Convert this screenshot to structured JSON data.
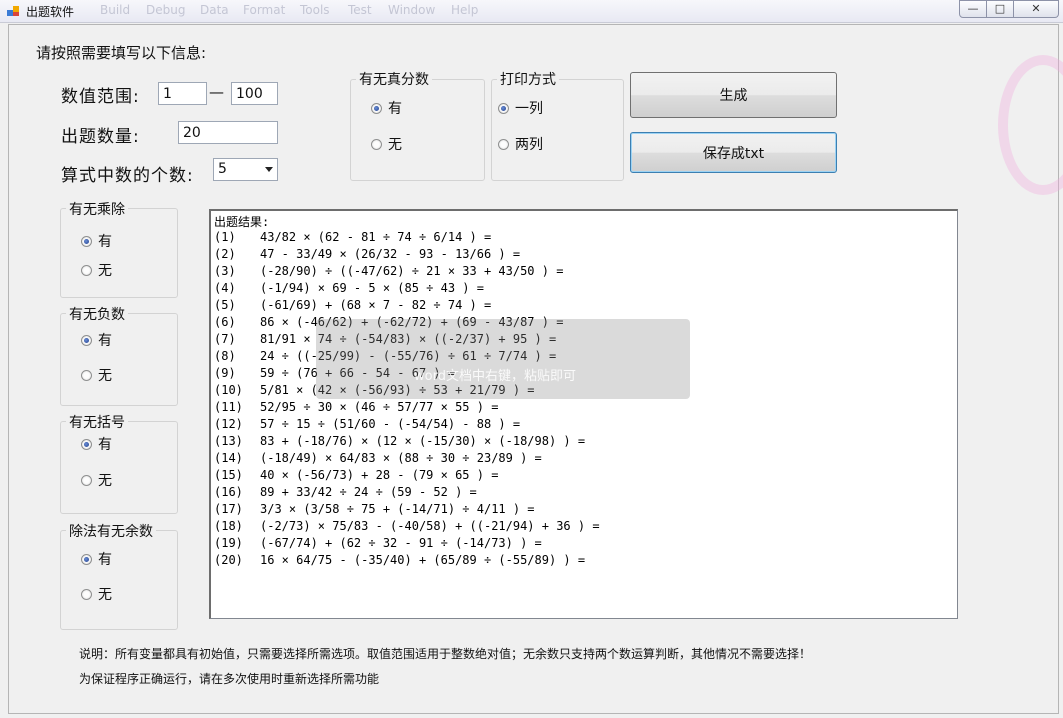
{
  "window": {
    "title": "出题软件",
    "ghost_menu": [
      "Build",
      "Debug",
      "Data",
      "Format",
      "Tools",
      "Test",
      "Window",
      "Help"
    ],
    "controls": {
      "minimize": "—",
      "maximize": "□",
      "close": "✕"
    }
  },
  "form": {
    "instruction": "请按照需要填写以下信息:",
    "range_label": "数值范围:",
    "range_min": "1",
    "range_dash": "—",
    "range_max": "100",
    "count_label": "出题数量:",
    "count_value": "20",
    "operand_label": "算式中数的个数:",
    "operand_value": "5"
  },
  "groups": {
    "fraction": {
      "title": "有无真分数",
      "options": [
        "有",
        "无"
      ],
      "selected": 0
    },
    "print": {
      "title": "打印方式",
      "options": [
        "一列",
        "两列"
      ],
      "selected": 0
    },
    "muldiv": {
      "title": "有无乘除",
      "options": [
        "有",
        "无"
      ],
      "selected": 0
    },
    "negative": {
      "title": "有无负数",
      "options": [
        "有",
        "无"
      ],
      "selected": 0
    },
    "parens": {
      "title": "有无括号",
      "options": [
        "有",
        "无"
      ],
      "selected": 0
    },
    "remainder": {
      "title": "除法有无余数",
      "options": [
        "有",
        "无"
      ],
      "selected": 0
    }
  },
  "buttons": {
    "generate": "生成",
    "save": "保存成txt"
  },
  "output": {
    "header": "出题结果:",
    "lines": [
      {
        "n": "(1)",
        "expr": "43/82 × (62 - 81 ÷ 74 ÷ 6/14 ) ="
      },
      {
        "n": "(2)",
        "expr": "47 - 33/49 × (26/32 - 93 - 13/66 ) ="
      },
      {
        "n": "(3)",
        "expr": "(-28/90) ÷ ((-47/62) ÷ 21 × 33 + 43/50 ) ="
      },
      {
        "n": "(4)",
        "expr": "(-1/94) × 69 - 5 × (85 ÷ 43 ) ="
      },
      {
        "n": "(5)",
        "expr": "(-61/69) + (68 × 7 - 82 ÷ 74 ) ="
      },
      {
        "n": "(6)",
        "expr": "86 × (-46/62) + (-62/72) + (69 - 43/87 ) ="
      },
      {
        "n": "(7)",
        "expr": "81/91 × 74 ÷ (-54/83) × ((-2/37) + 95 ) ="
      },
      {
        "n": "(8)",
        "expr": "24 ÷ ((-25/99) - (-55/76) ÷ 61 ÷ 7/74 ) ="
      },
      {
        "n": "(9)",
        "expr": "59 ÷ (76 + 66 - 54 - 67 ) ="
      },
      {
        "n": "(10)",
        "expr": "5/81 × (42 × (-56/93) ÷ 53 + 21/79 ) ="
      },
      {
        "n": "(11)",
        "expr": "52/95 ÷ 30 × (46 ÷ 57/77 × 55 ) ="
      },
      {
        "n": "(12)",
        "expr": "57 ÷ 15 ÷ (51/60 - (-54/54) - 88 ) ="
      },
      {
        "n": "(13)",
        "expr": "83 + (-18/76) × (12 × (-15/30) × (-18/98) ) ="
      },
      {
        "n": "(14)",
        "expr": "(-18/49) × 64/83 × (88 ÷ 30 ÷ 23/89 ) ="
      },
      {
        "n": "(15)",
        "expr": "40 × (-56/73) + 28 - (79 × 65 ) ="
      },
      {
        "n": "(16)",
        "expr": "89 + 33/42 ÷ 24 ÷ (59 - 52 ) ="
      },
      {
        "n": "(17)",
        "expr": "3/3 × (3/58 ÷ 75 + (-14/71) ÷ 4/11 ) ="
      },
      {
        "n": "(18)",
        "expr": "(-2/73) × 75/83 - (-40/58) + ((-21/94) + 36 ) ="
      },
      {
        "n": "(19)",
        "expr": "(-67/74) + (62 ÷ 32 - 91 ÷ (-14/73) ) ="
      },
      {
        "n": "(20)",
        "expr": "16 × 64/75 - (-35/40) + (65/89 ÷ (-55/89) ) ="
      }
    ]
  },
  "tooltip": "word文档中右键，粘贴即可",
  "notes": {
    "line1": "说明：所有变量都具有初始值，只需要选择所需选项。取值范围适用于整数绝对值；无余数只支持两个数运算判断，其他情况不需要选择！",
    "line2": "为保证程序正确运行，请在多次使用时重新选择所需功能"
  }
}
